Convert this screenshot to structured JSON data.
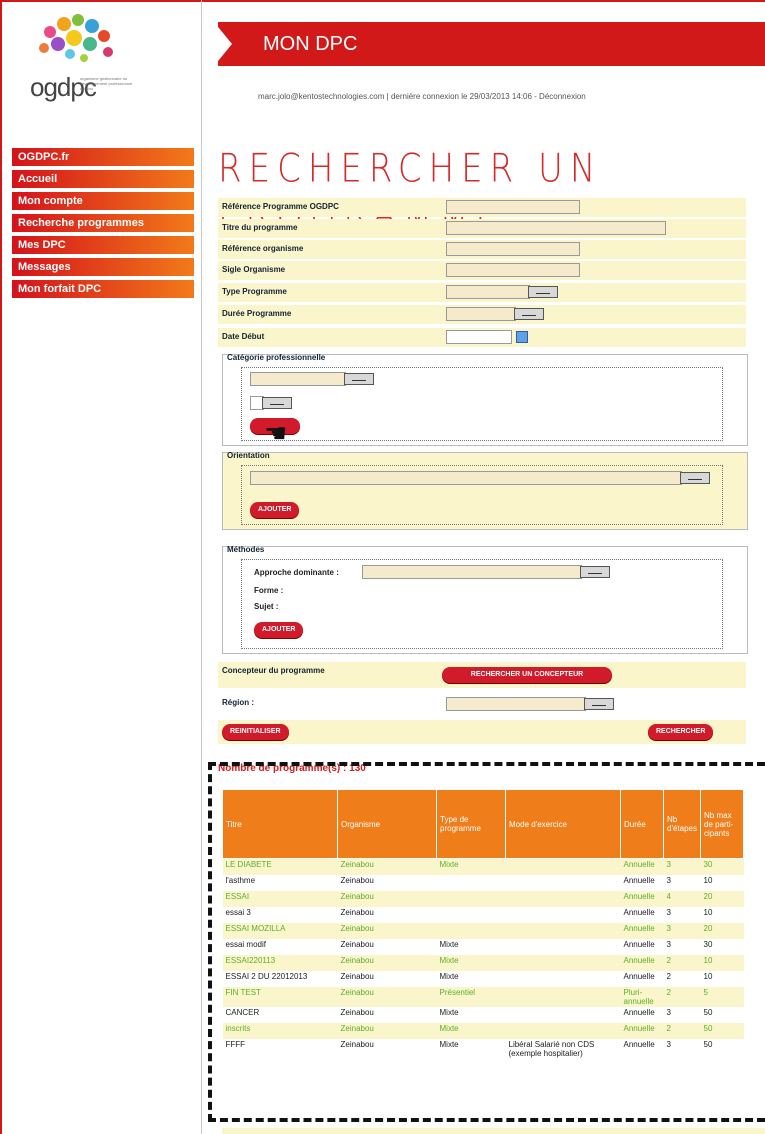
{
  "brand": {
    "logo_text": "ogdpc",
    "logo_tagline": "organisme gestionnaire du développement professionnel continu"
  },
  "menu": [
    {
      "label": "OGDPC.fr"
    },
    {
      "label": "Accueil"
    },
    {
      "label": "Mon compte"
    },
    {
      "label": "Recherche programmes"
    },
    {
      "label": "Mes DPC"
    },
    {
      "label": "Messages"
    },
    {
      "label": "Mon forfait DPC"
    }
  ],
  "header": {
    "title": "MON DPC",
    "user_email": "marc.jolo@kentostechnologies.com",
    "last_connection": "dernière connexion le 29/03/2013 14:06",
    "logout": "Déconnexion"
  },
  "page_title": "RECHERCHER UN PROGRAMME",
  "form": {
    "ref_ogdpc_label": "Référence Programme OGDPC",
    "titre_label": "Titre du programme",
    "ref_org_label": "Référence organisme",
    "sigle_label": "Sigle Organisme",
    "type_label": "Type Programme",
    "duree_label": "Durée Programme",
    "date_label": "Date Début",
    "categorie_legend": "Catégorie professionnelle",
    "orientation_legend": "Orientation",
    "methodes_legend": "Méthodes",
    "approche_label": "Approche dominante :",
    "forme_label": "Forme :",
    "sujet_label": "Sujet :",
    "ajouter": "AJOUTER",
    "concepteur_label": "Concepteur du programme",
    "rechercher_concepteur": "RECHERCHER UN CONCEPTEUR",
    "region_label": "Région :",
    "reinit": "REINITIALISER",
    "rechercher": "RECHERCHER"
  },
  "results": {
    "count_label": "Nombre de programme(s) : 130",
    "headers": [
      "Titre",
      "Organisme",
      "Type de programme",
      "Mode d'exercice",
      "Durée",
      "Nb d'étapes",
      "Nb max de parti-cipants"
    ],
    "rows": [
      [
        "LE DIABETE",
        "Zeinabou",
        "Mixte",
        "",
        "Annuelle",
        "3",
        "30"
      ],
      [
        "l'asthme",
        "Zeinabou",
        "",
        "",
        "Annuelle",
        "3",
        "10"
      ],
      [
        "ESSAI",
        "Zeinabou",
        "",
        "",
        "Annuelle",
        "4",
        "20"
      ],
      [
        "essai 3",
        "Zeinabou",
        "",
        "",
        "Annuelle",
        "3",
        "10"
      ],
      [
        "ESSAI MOZILLA",
        "Zeinabou",
        "",
        "",
        "Annuelle",
        "3",
        "20"
      ],
      [
        "essai modif",
        "Zeinabou",
        "Mixte",
        "",
        "Annuelle",
        "3",
        "30"
      ],
      [
        "ESSAI220113",
        "Zeinabou",
        "Mixte",
        "",
        "Annuelle",
        "2",
        "10"
      ],
      [
        "ESSAI 2 DU 22012013",
        "Zeinabou",
        "Mixte",
        "",
        "Annuelle",
        "2",
        "10"
      ],
      [
        "FIN TEST",
        "Zeinabou",
        "Présentiel",
        "",
        "Pluri-annuelle",
        "2",
        "5"
      ],
      [
        "CANCER",
        "Zeinabou",
        "Mixte",
        "",
        "Annuelle",
        "3",
        "50"
      ],
      [
        "inscrits",
        "Zeinabou",
        "Mixte",
        "",
        "Annuelle",
        "2",
        "50"
      ],
      [
        "FFFF",
        "Zeinabou",
        "Mixte",
        "Libéral Salarié non CDS (exemple hospitalier)",
        "Annuelle",
        "3",
        "50"
      ]
    ]
  }
}
